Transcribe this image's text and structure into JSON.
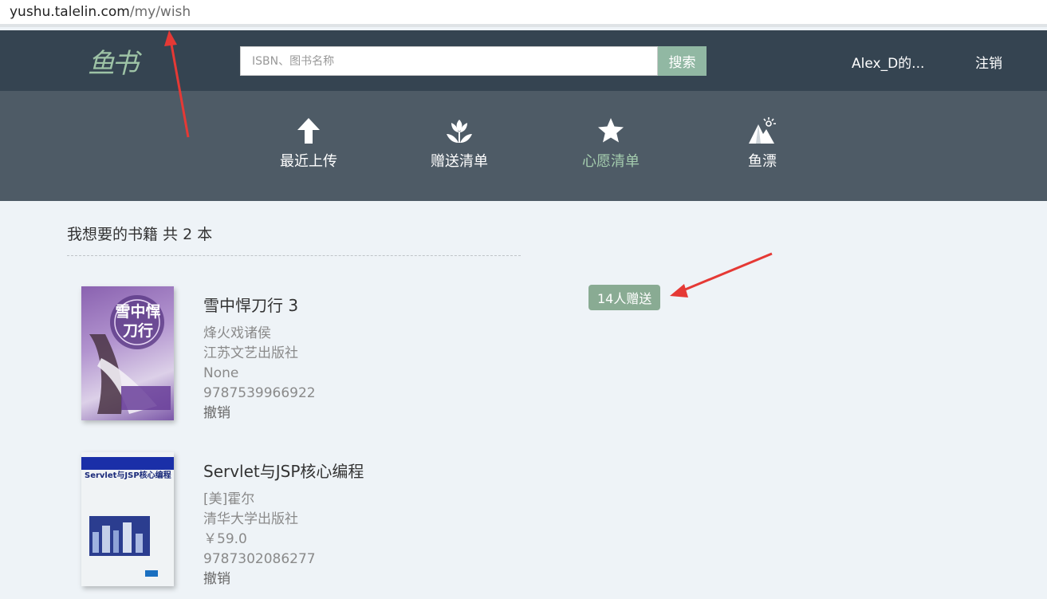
{
  "browser": {
    "url_host": "yushu.talelin.com",
    "url_path": "/my/wish"
  },
  "header": {
    "logo_text": "鱼书",
    "search_placeholder": "ISBN、图书名称",
    "search_button": "搜索",
    "user_name": "Alex_D的...",
    "logout": "注销"
  },
  "nav": {
    "items": [
      {
        "label": "最近上传",
        "icon": "arrow-up-icon",
        "active": false
      },
      {
        "label": "赠送清单",
        "icon": "flower-icon",
        "active": false
      },
      {
        "label": "心愿清单",
        "icon": "star-icon",
        "active": true
      },
      {
        "label": "鱼漂",
        "icon": "mountain-sun-icon",
        "active": false
      }
    ]
  },
  "wishlist": {
    "title": "我想要的书籍 共 2 本",
    "books": [
      {
        "title": "雪中悍刀行 3",
        "author": "烽火戏诸侯",
        "publisher": "江苏文艺出版社",
        "price": "None",
        "isbn": "9787539966922",
        "action": "撤销",
        "cover_text": "雪中悍刀行",
        "badge": "14人赠送"
      },
      {
        "title": "Servlet与JSP核心编程",
        "author": "[美]霍尔",
        "publisher": "清华大学出版社",
        "price": "￥59.0",
        "isbn": "9787302086277",
        "action": "撤销",
        "cover_text": "Servlet与JSP核心编程"
      }
    ]
  },
  "colors": {
    "topbar": "#354451",
    "navbar": "#4e5b66",
    "accent": "#91b8a3",
    "annotation_arrow": "#e53935"
  }
}
